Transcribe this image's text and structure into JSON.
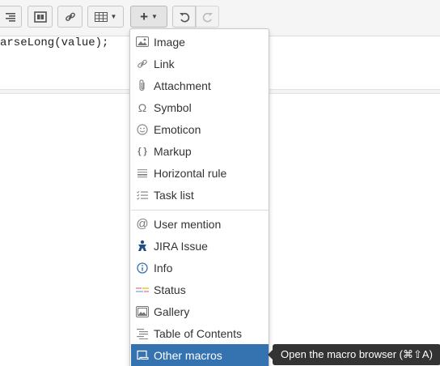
{
  "editor": {
    "code_line": "arseLong(value);"
  },
  "insert_menu": {
    "items_group1": [
      {
        "label": "Image",
        "icon": "image-icon"
      },
      {
        "label": "Link",
        "icon": "link-icon"
      },
      {
        "label": "Attachment",
        "icon": "paperclip-icon"
      },
      {
        "label": "Symbol",
        "icon": "omega-icon"
      },
      {
        "label": "Emoticon",
        "icon": "smiley-icon"
      },
      {
        "label": "Markup",
        "icon": "braces-icon"
      },
      {
        "label": "Horizontal rule",
        "icon": "horizontal-rule-icon"
      },
      {
        "label": "Task list",
        "icon": "task-list-icon"
      }
    ],
    "items_group2": [
      {
        "label": "User mention",
        "icon": "at-icon"
      },
      {
        "label": "JIRA Issue",
        "icon": "jira-icon"
      },
      {
        "label": "Info",
        "icon": "info-icon"
      },
      {
        "label": "Status",
        "icon": "status-lozenge-icon"
      },
      {
        "label": "Gallery",
        "icon": "gallery-icon"
      },
      {
        "label": "Table of Contents",
        "icon": "toc-icon"
      },
      {
        "label": "Other macros",
        "icon": "macro-icon"
      }
    ],
    "selected_item": "Other macros"
  },
  "tooltip": {
    "text": "Open the macro browser (⌘⇧A)"
  },
  "colors": {
    "selection": "#3572b0",
    "tooltip_bg": "#333333"
  }
}
